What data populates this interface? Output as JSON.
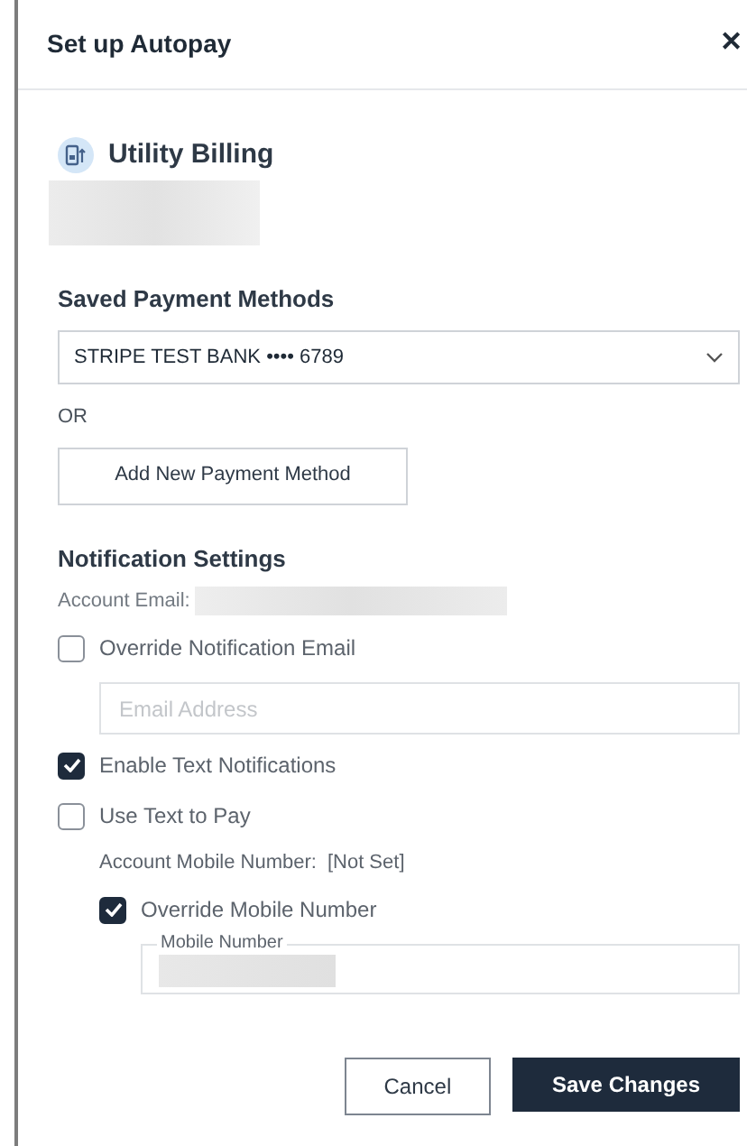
{
  "dialog": {
    "title": "Set up Autopay",
    "close": "✕"
  },
  "account": {
    "name": "Utility Billing"
  },
  "payment": {
    "heading": "Saved Payment Methods",
    "selected_method": "STRIPE TEST BANK •••• 6789",
    "or": "OR",
    "add_button": "Add New Payment Method"
  },
  "notifications": {
    "heading": "Notification Settings",
    "account_email_label": "Account Email:",
    "override_email": {
      "label": "Override Notification Email",
      "checked": false
    },
    "email_field": {
      "placeholder": "Email Address"
    },
    "enable_text": {
      "label": "Enable Text Notifications",
      "checked": true
    },
    "text_to_pay": {
      "label": "Use Text to Pay",
      "checked": false
    },
    "account_mobile_label": "Account Mobile Number:",
    "account_mobile_value": "[Not Set]",
    "override_mobile": {
      "label": "Override Mobile Number",
      "checked": true
    },
    "mobile_field": {
      "label": "Mobile Number"
    }
  },
  "buttons": [
    {
      "label": "Cancel",
      "kind": "secondary"
    },
    {
      "label": "Save Changes",
      "kind": "primary"
    }
  ]
}
